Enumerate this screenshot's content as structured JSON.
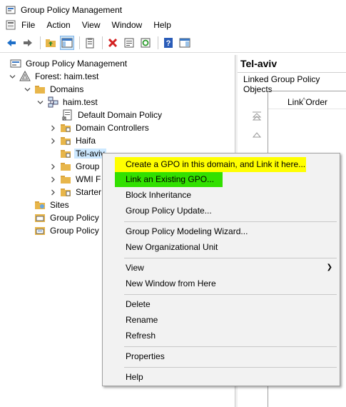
{
  "window": {
    "title": "Group Policy Management"
  },
  "menu": [
    "File",
    "Action",
    "View",
    "Window",
    "Help"
  ],
  "toolbar": [
    "back-icon",
    "forward-icon",
    "up-folder-icon",
    "show-hide-tree-icon",
    "clipboard-icon",
    "delete-icon",
    "properties-icon",
    "refresh-icon",
    "help-icon",
    "panel-icon"
  ],
  "tree": {
    "root": "Group Policy Management",
    "forest": "Forest: haim.test",
    "domains": "Domains",
    "domain": "haim.test",
    "ddp": "Default Domain Policy",
    "dc": "Domain Controllers",
    "haifa": "Haifa",
    "telaviv": "Tel-aviv",
    "group_trunc": "Group",
    "wmi_trunc": "WMI F",
    "starter_trunc": "Starter",
    "sites": "Sites",
    "gpm_trunc": "Group Policy",
    "gpr_trunc": "Group Policy"
  },
  "right": {
    "heading": "Tel-aviv",
    "tab": "Linked Group Policy Objects",
    "column": "Link Order"
  },
  "context_menu": {
    "create_gpo": "Create a GPO in this domain, and Link it here...",
    "link_existing": "Link an Existing GPO...",
    "block_inheritance": "Block Inheritance",
    "gp_update": "Group Policy Update...",
    "modeling_wizard": "Group Policy Modeling Wizard...",
    "new_ou": "New Organizational Unit",
    "view": "View",
    "new_window": "New Window from Here",
    "delete": "Delete",
    "rename": "Rename",
    "refresh": "Refresh",
    "properties": "Properties",
    "help": "Help"
  },
  "colors": {
    "highlight_yellow": "#ffff00",
    "highlight_green": "#32e000",
    "selection": "#cce8ff",
    "folder": "#e8b64a"
  }
}
